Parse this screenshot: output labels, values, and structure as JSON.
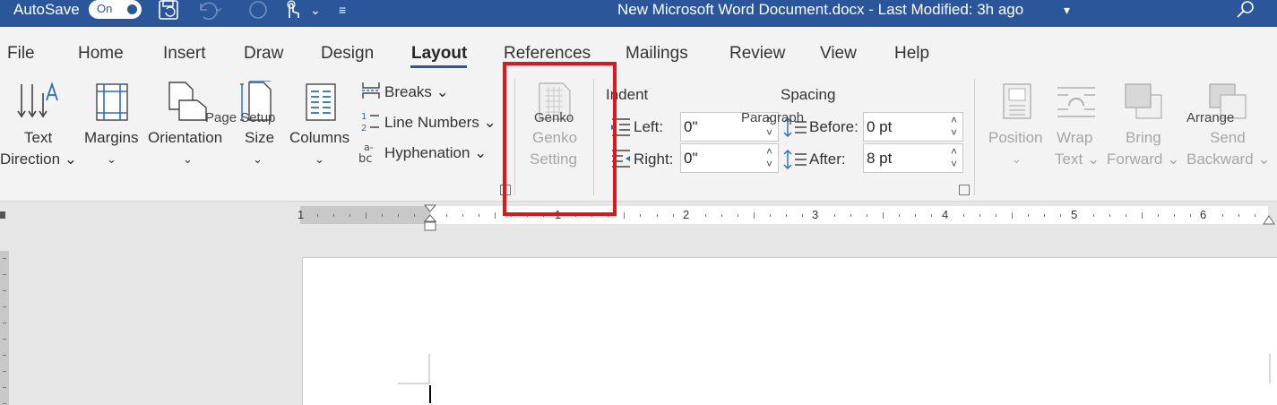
{
  "titlebar": {
    "autosave_label": "AutoSave",
    "autosave_state": "On",
    "document_title": "New Microsoft Word Document.docx  -  Last Modified: 3h ago",
    "title_chevron": "▾",
    "more_chevron": "⌄",
    "customize": "≡"
  },
  "tabs": [
    {
      "label": "File"
    },
    {
      "label": "Home"
    },
    {
      "label": "Insert"
    },
    {
      "label": "Draw"
    },
    {
      "label": "Design"
    },
    {
      "label": "Layout"
    },
    {
      "label": "References"
    },
    {
      "label": "Mailings"
    },
    {
      "label": "Review"
    },
    {
      "label": "View"
    },
    {
      "label": "Help"
    }
  ],
  "page_setup": {
    "text_direction_1": "Text",
    "text_direction_2": "Direction ⌄",
    "margins": "Margins",
    "orientation": "Orientation",
    "size": "Size",
    "columns": "Columns",
    "breaks": "Breaks ⌄",
    "line_numbers": "Line Numbers ⌄",
    "hyphenation": "Hyphenation ⌄",
    "dropdown": "⌄",
    "group_label": "Page Setup"
  },
  "genko": {
    "button_1": "Genko",
    "button_2": "Setting",
    "group_label": "Genko"
  },
  "paragraph": {
    "indent_title": "Indent",
    "left_label": "Left:",
    "left_value": "0\"",
    "right_label": "Right:",
    "right_value": "0\"",
    "spacing_title": "Spacing",
    "before_label": "Before:",
    "before_value": "0 pt",
    "after_label": "After:",
    "after_value": "8 pt",
    "spin_arrows": "˄\n˅",
    "group_label": "Paragraph"
  },
  "arrange": {
    "position": "Position",
    "wrap_1": "Wrap",
    "wrap_2": "Text ⌄",
    "bring_1": "Bring",
    "bring_2": "Forward ⌄",
    "send_1": "Send",
    "send_2": "Backward ⌄",
    "dropdown": "⌄",
    "group_label": "Arrange"
  },
  "ruler": {
    "numbers": [
      "1",
      "1",
      "2",
      "3",
      "4",
      "5",
      "6"
    ]
  },
  "colors": {
    "titlebar": "#2b579a",
    "highlight": "#e0161c",
    "ribbon": "#f3f3f3"
  },
  "icons": [
    "save-icon",
    "undo-icon",
    "redo-icon",
    "touch-mode-icon",
    "search-icon",
    "text-direction-icon",
    "margins-icon",
    "orientation-icon",
    "size-icon",
    "columns-icon",
    "breaks-icon",
    "line-numbers-icon",
    "hyphenation-icon",
    "genko-setting-icon",
    "indent-left-icon",
    "indent-right-icon",
    "spacing-before-icon",
    "spacing-after-icon",
    "position-icon",
    "wrap-text-icon",
    "bring-forward-icon",
    "send-backward-icon"
  ]
}
